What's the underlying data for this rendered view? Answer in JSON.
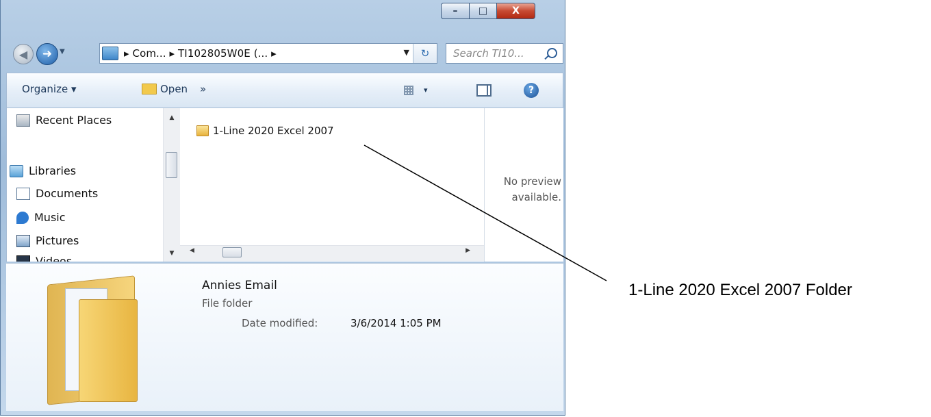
{
  "window": {
    "caption": {
      "minimize": "–",
      "maximize": "□",
      "close": "X"
    }
  },
  "navbar": {
    "back_glyph": "◀",
    "forward_glyph": "➜",
    "address_text": "▸ Com... ▸ TI102805W0E (... ▸",
    "search_placeholder": "Search TI10..."
  },
  "toolbar": {
    "organize_label": "Organize ▾",
    "open_label": "Open",
    "more_label": "»",
    "views_drop": "▾",
    "help_glyph": "?"
  },
  "sidebar": {
    "items": [
      {
        "label": "Recent Places",
        "icon": "recent-places-icon"
      },
      {
        "label": "Libraries",
        "icon": "libraries-icon"
      },
      {
        "label": "Documents",
        "icon": "documents-icon"
      },
      {
        "label": "Music",
        "icon": "music-icon"
      },
      {
        "label": "Pictures",
        "icon": "pictures-icon"
      },
      {
        "label": "Videos",
        "icon": "videos-icon"
      }
    ]
  },
  "file_list": {
    "items": [
      {
        "name": "1-Line 2020 Excel 2007",
        "icon": "folder-icon"
      }
    ]
  },
  "preview": {
    "text": "No preview\navailable."
  },
  "details": {
    "name": "Annies Email",
    "type": "File folder",
    "date_label": "Date modified:",
    "date_value": "3/6/2014 1:05 PM"
  },
  "annotation": {
    "label": "1-Line 2020 Excel 2007 Folder"
  }
}
